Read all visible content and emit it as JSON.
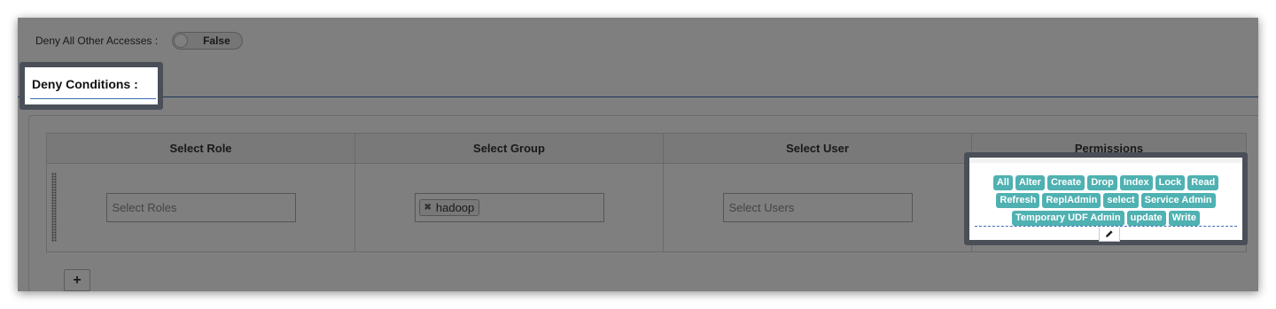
{
  "deny_all": {
    "label": "Deny All Other Accesses :",
    "toggle_value": "False"
  },
  "section": {
    "title": "Deny Conditions :"
  },
  "table": {
    "headers": [
      "Select Role",
      "Select Group",
      "Select User",
      "Permissions"
    ],
    "row": {
      "role_placeholder": "Select Roles",
      "group_tags": [
        "hadoop"
      ],
      "user_placeholder": "Select Users",
      "permissions": [
        "All",
        "Alter",
        "Create",
        "Drop",
        "Index",
        "Lock",
        "Read",
        "Refresh",
        "ReplAdmin",
        "select",
        "Service Admin",
        "Temporary UDF Admin",
        "update",
        "Write"
      ]
    }
  },
  "add_button": {
    "label": "+"
  },
  "colors": {
    "accent": "#3b6db3",
    "badge": "#4fb1b1",
    "callout_border": "#4a4f58"
  },
  "icons": {
    "edit": "pencil-icon",
    "remove_tag": "close-icon",
    "drag": "drag-handle-icon"
  }
}
